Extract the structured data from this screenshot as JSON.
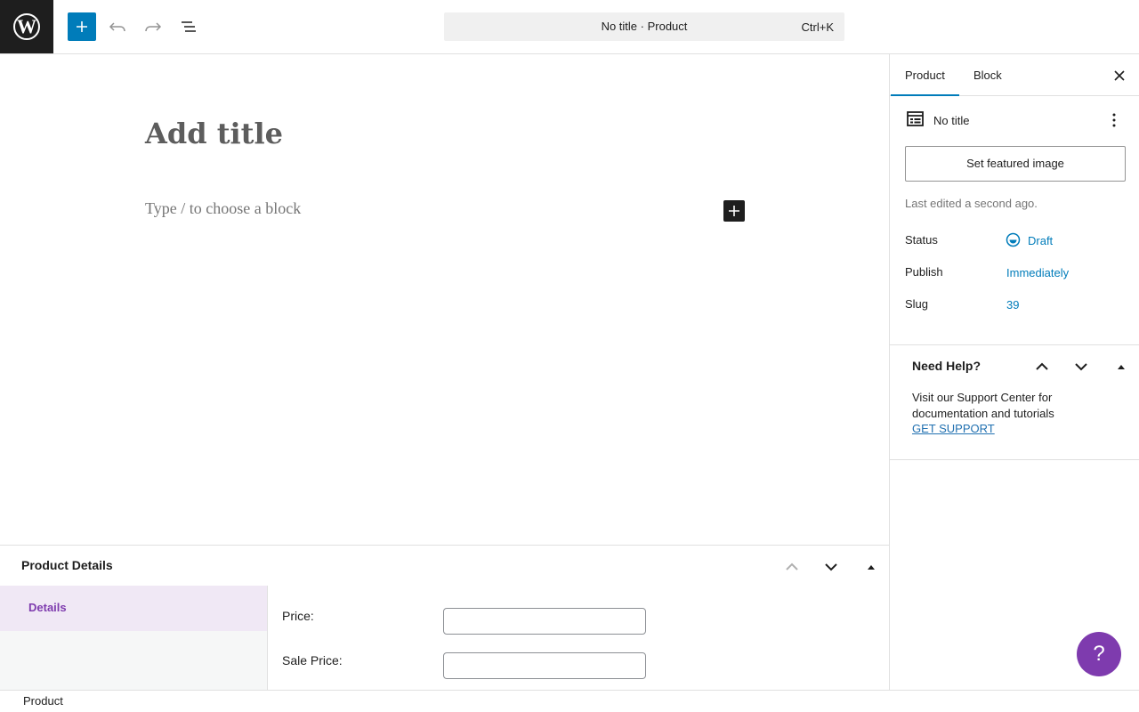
{
  "toolbar": {
    "logo_icon": "wordpress-logo",
    "add_icon": "plus-icon",
    "undo_icon": "undo-icon",
    "redo_icon": "redo-icon",
    "list_view_icon": "list-view-icon",
    "command_title": "No title · Product",
    "command_shortcut": "Ctrl+K",
    "accent_color": "#007cba"
  },
  "editor": {
    "title_placeholder": "Add title",
    "block_placeholder": "Type / to choose a block",
    "inserter_icon": "plus-icon"
  },
  "sidebar": {
    "tabs": [
      {
        "label": "Product",
        "active": true
      },
      {
        "label": "Block",
        "active": false
      }
    ],
    "close_icon": "close-icon",
    "post_card": {
      "title": "No title",
      "icon": "post-layout-icon",
      "more_icon": "vertical-ellipsis-icon"
    },
    "featured_image_button": "Set featured image",
    "last_edited": "Last edited a second ago.",
    "meta": [
      {
        "label": "Status",
        "value": "Draft",
        "icon": "draft-status-icon"
      },
      {
        "label": "Publish",
        "value": "Immediately"
      },
      {
        "label": "Slug",
        "value": "39"
      }
    ],
    "help_panel": {
      "title": "Need Help?",
      "text": "Visit our Support Center for documentation and tutorials",
      "link": "GET SUPPORT"
    }
  },
  "metabox": {
    "title": "Product Details",
    "nav_items": [
      "Details"
    ],
    "fields": [
      {
        "label": "Price:",
        "value": ""
      },
      {
        "label": "Sale Price:",
        "value": ""
      }
    ],
    "accent_color": "#7e3bae"
  },
  "footer": {
    "breadcrumb": "Product"
  },
  "help_fab": {
    "label": "?"
  }
}
